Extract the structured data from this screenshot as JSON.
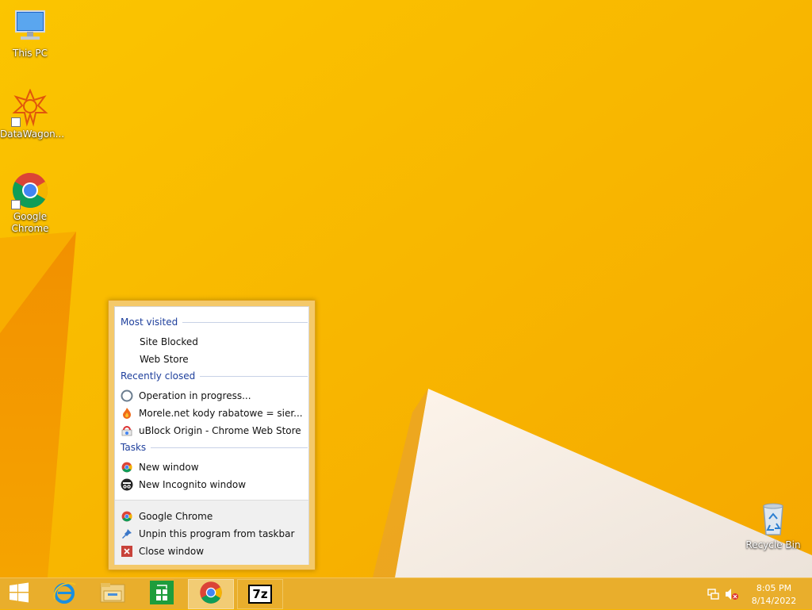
{
  "desktop": {
    "icons": [
      {
        "label": "This PC",
        "icon": "this-pc-icon"
      },
      {
        "label": "DataWagon...",
        "icon": "datawagon-icon"
      },
      {
        "label": "Google Chrome",
        "icon": "chrome-icon"
      },
      {
        "label": "Recycle Bin",
        "icon": "recycle-bin-icon"
      }
    ]
  },
  "jumplist": {
    "most_visited_title": "Most visited",
    "most_visited": [
      "Site Blocked",
      "Web Store"
    ],
    "recently_closed_title": "Recently closed",
    "recently_closed": [
      {
        "label": "Operation in progress...",
        "icon": "loading-circle-icon"
      },
      {
        "label": "Morele.net kody rabatowe = sier...",
        "icon": "flame-icon"
      },
      {
        "label": "uBlock Origin - Chrome Web Store",
        "icon": "web-store-icon"
      }
    ],
    "tasks_title": "Tasks",
    "tasks": [
      {
        "label": "New window",
        "icon": "chrome-icon"
      },
      {
        "label": "New Incognito window",
        "icon": "incognito-icon"
      }
    ],
    "footer": [
      {
        "label": "Google Chrome",
        "icon": "chrome-icon"
      },
      {
        "label": "Unpin this program from taskbar",
        "icon": "unpin-icon"
      },
      {
        "label": "Close window",
        "icon": "close-icon"
      }
    ]
  },
  "taskbar": {
    "buttons": [
      "start",
      "internet-explorer",
      "file-explorer",
      "store",
      "chrome",
      "7zip"
    ],
    "sevenzip_label": "7z",
    "clock_time": "8:05 PM",
    "clock_date": "8/14/2022"
  },
  "colors": {
    "background": "#f7b600",
    "taskbar": "#e9ae2c",
    "section_title": "#1e3f9c"
  }
}
